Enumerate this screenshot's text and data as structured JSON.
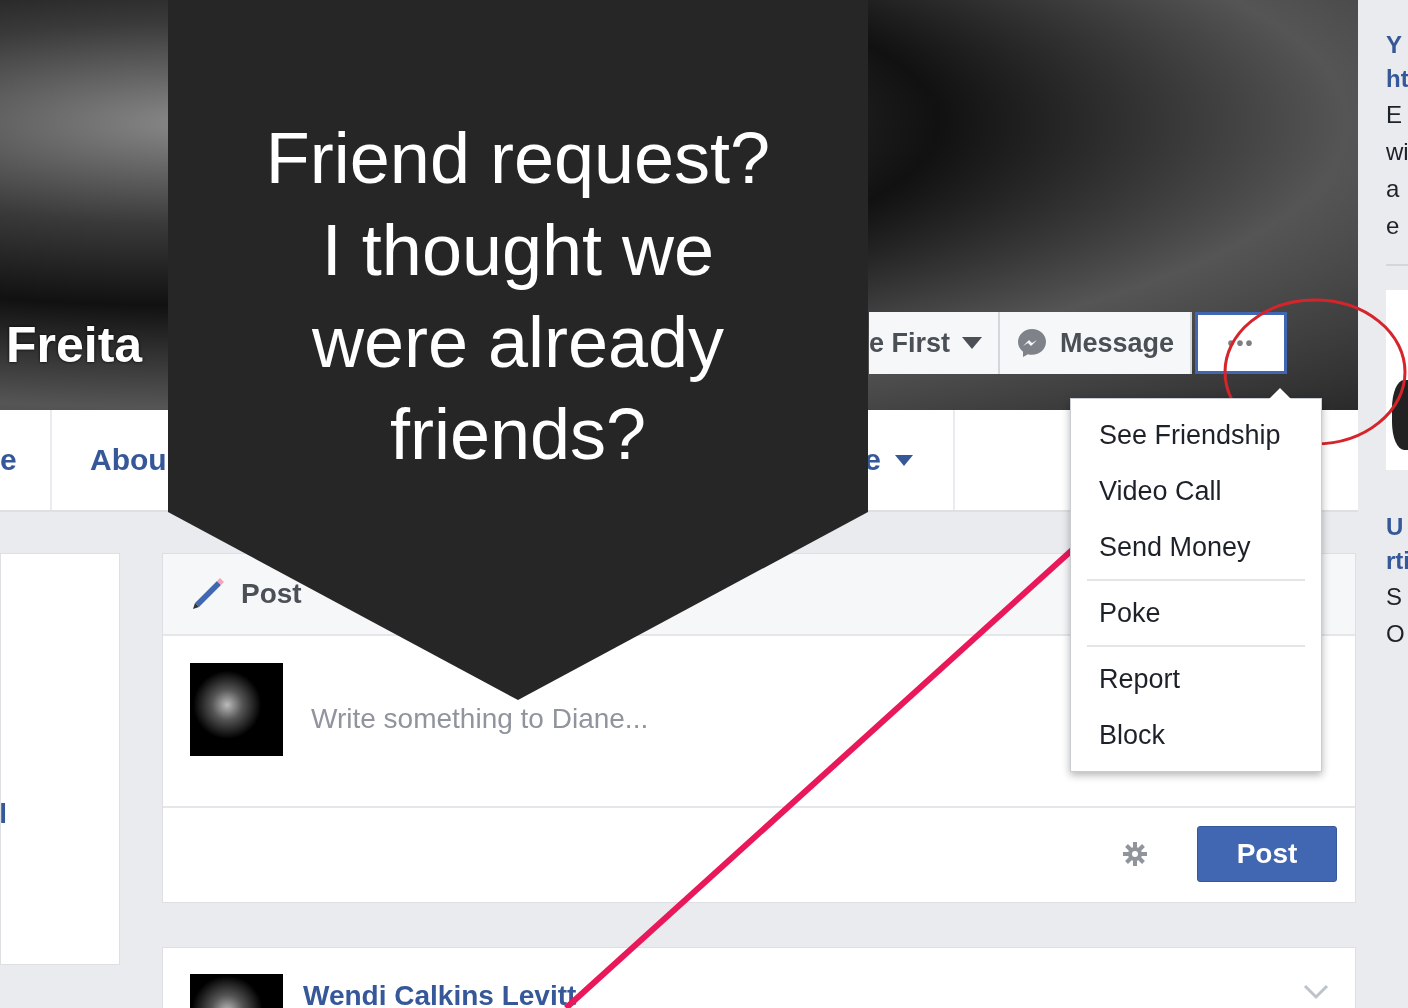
{
  "profile_header": {
    "name": "Freita",
    "actions": [
      {
        "kind": "dropdown",
        "label": "e First",
        "selected": false
      },
      {
        "kind": "message",
        "label": "Message",
        "selected": false
      },
      {
        "kind": "more",
        "label": "•••",
        "selected": true
      }
    ]
  },
  "profile_tabs": [
    {
      "label": "e",
      "dropdown": false
    },
    {
      "label": "Abou",
      "dropdown": false
    },
    {
      "label": "e",
      "dropdown": true
    }
  ],
  "left_card": {
    "text": "l"
  },
  "composer": {
    "tab": "Post",
    "placeholder": "Write something to Diane...",
    "button": "Post"
  },
  "post": {
    "author": "Wendi Calkins Levitt"
  },
  "right_column": {
    "items": [
      {
        "kind": "link",
        "text": "Y"
      },
      {
        "kind": "link",
        "text": "ht"
      },
      {
        "kind": "text",
        "text": "E"
      },
      {
        "kind": "text",
        "text": "wi"
      },
      {
        "kind": "text",
        "text": "a"
      },
      {
        "kind": "text",
        "text": "e"
      },
      {
        "kind": "divider"
      },
      {
        "kind": "photo"
      },
      {
        "kind": "link",
        "text": "U"
      },
      {
        "kind": "link",
        "text": "rti"
      },
      {
        "kind": "text",
        "text": "S"
      },
      {
        "kind": "text",
        "text": "O"
      }
    ]
  },
  "more_menu": {
    "groups": [
      [
        "See Friendship",
        "Video Call",
        "Send Money"
      ],
      [
        "Poke"
      ],
      [
        "Report",
        "Block"
      ]
    ]
  },
  "callout": {
    "lines": [
      "Friend request?",
      "I thought we",
      "were already",
      "friends?"
    ]
  }
}
